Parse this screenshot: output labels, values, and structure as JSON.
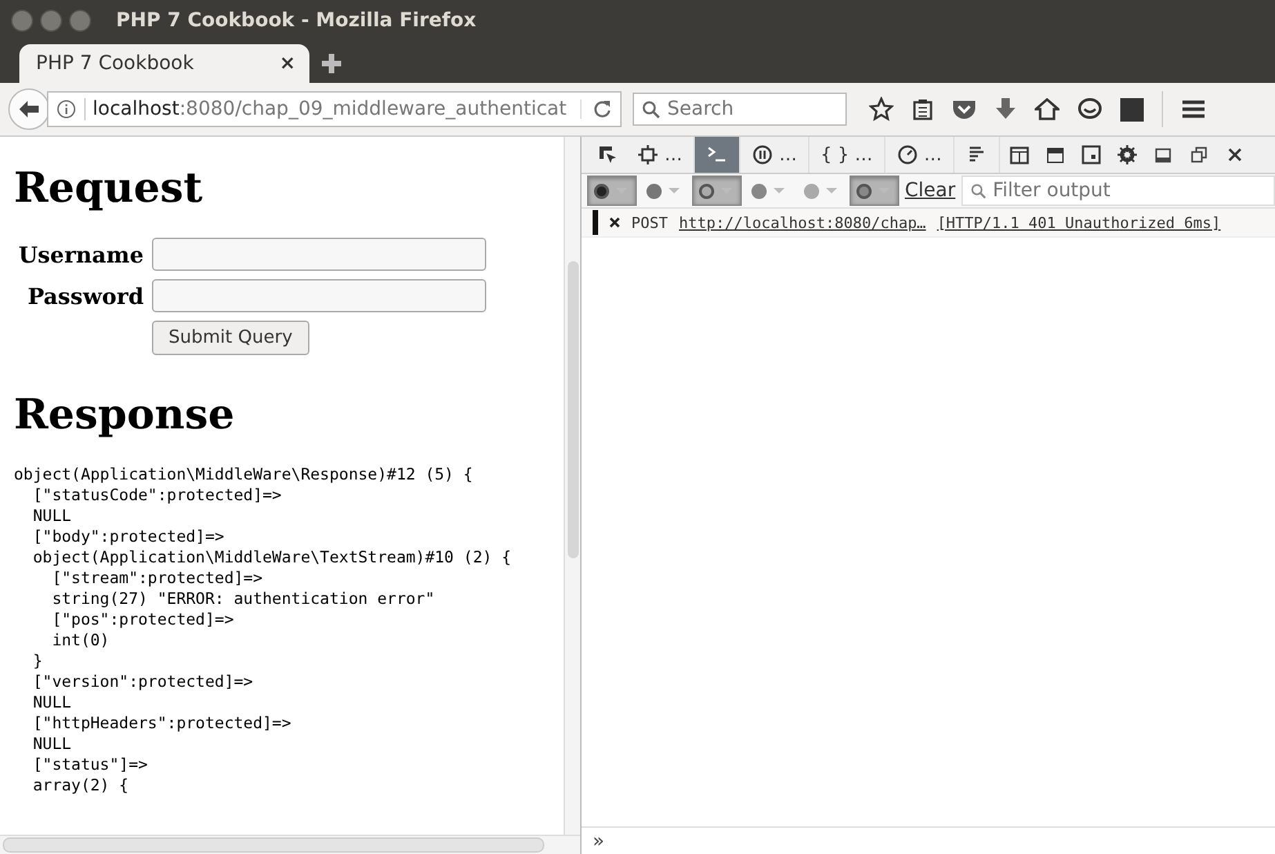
{
  "window": {
    "title": "PHP 7 Cookbook - Mozilla Firefox"
  },
  "tabs": [
    {
      "label": "PHP 7 Cookbook",
      "selected": true,
      "close": "×"
    }
  ],
  "address_bar": {
    "host": "localhost",
    "rest": ":8080/chap_09_middleware_authenticat"
  },
  "search": {
    "placeholder": "Search"
  },
  "page": {
    "request_heading": "Request",
    "fields": [
      {
        "label": "Username"
      },
      {
        "label": "Password"
      }
    ],
    "submit": "Submit Query",
    "response_heading": "Response",
    "output_lines": [
      "object(Application\\MiddleWare\\Response)#12 (5) {",
      "  [\"statusCode\":protected]=>",
      "  NULL",
      "  [\"body\":protected]=>",
      "  object(Application\\MiddleWare\\TextStream)#10 (2) {",
      "    [\"stream\":protected]=>",
      "    string(27) \"ERROR: authentication error\"",
      "    [\"pos\":protected]=>",
      "    int(0)",
      "  }",
      "  [\"version\":protected]=>",
      "  NULL",
      "  [\"httpHeaders\":protected]=>",
      "  NULL",
      "  [\"status\"]=>",
      "  array(2) {"
    ]
  },
  "devtools": {
    "tools": [
      {
        "kind": "inspector",
        "label": "…",
        "selected": false
      },
      {
        "kind": "console",
        "selected": true
      },
      {
        "kind": "debugger",
        "label": "…",
        "selected": false
      },
      {
        "kind": "style",
        "label": "{ } …",
        "selected": false
      },
      {
        "kind": "performance",
        "label": "…",
        "selected": false
      },
      {
        "kind": "network",
        "selected": false
      }
    ],
    "filters": [
      {
        "on": true
      },
      {
        "on": false
      },
      {
        "on": true
      },
      {
        "on": false
      },
      {
        "on": false
      },
      {
        "on": true
      }
    ],
    "clear": "Clear",
    "filter_placeholder": "Filter output",
    "log": [
      {
        "method": "POST",
        "url": "http://localhost:8080/chap…",
        "status": "[HTTP/1.1 401 Unauthorized 6ms]"
      }
    ],
    "prompt": "»"
  }
}
